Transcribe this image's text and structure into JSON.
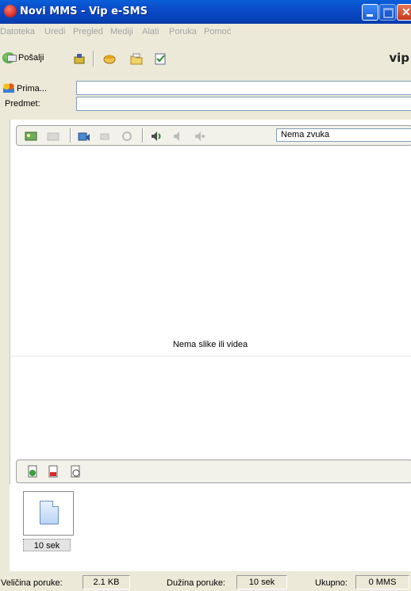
{
  "window": {
    "title": "Novi MMS - Vip e-SMS"
  },
  "menu": [
    "Datoteka",
    "Uredi",
    "Pregled",
    "Mediji",
    "Alati",
    "Poruka",
    "Pomoć"
  ],
  "toolbar": {
    "send_label": "Pošalji",
    "brand": "vip"
  },
  "fields": {
    "recipients_label": "Prima...",
    "recipients_value": "",
    "subject_label": "Predmet:",
    "subject_value": ""
  },
  "editor": {
    "sound_value": "Nema zvuka",
    "no_media_text": "Nema slike ili videa"
  },
  "slides": [
    {
      "label": "10 sek"
    }
  ],
  "status": {
    "size_label": "Veličina poruke:",
    "size_value": "2.1 KB",
    "length_label": "Dužina poruke:",
    "length_value": "10 sek",
    "total_label": "Ukupno:",
    "total_value": "0 MMS"
  }
}
